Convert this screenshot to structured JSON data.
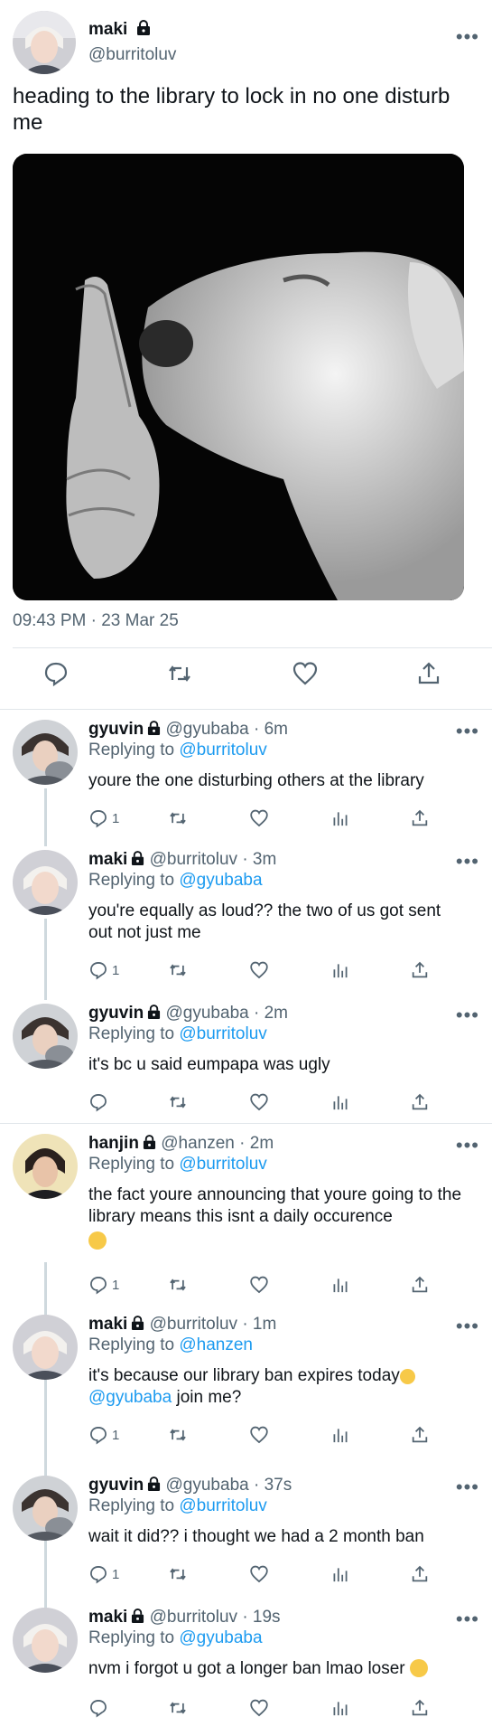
{
  "main": {
    "name": "maki",
    "handle": "@burritoluv",
    "text": "heading to the library to lock in no one disturb me",
    "time": "09:43 PM · 23 Mar 25"
  },
  "replies": [
    {
      "name": "gyuvin",
      "handle": "@gyubaba",
      "time": "· 6m",
      "reply_prefix": "Replying to",
      "reply_to": "@burritoluv",
      "text": "youre the one disturbing others at the library",
      "reply_count": "1",
      "avatar": "gyuvin"
    },
    {
      "name": "maki",
      "handle": "@burritoluv",
      "time": "· 3m",
      "reply_prefix": "Replying to",
      "reply_to": "@gyubaba",
      "text": "you're equally as loud?? the two of us got sent out not just me",
      "reply_count": "1",
      "avatar": "maki"
    },
    {
      "name": "gyuvin",
      "handle": "@gyubaba",
      "time": "· 2m",
      "reply_prefix": "Replying to",
      "reply_to": "@burritoluv",
      "text": "it's bc u said eumpapa was ugly",
      "reply_count": "",
      "avatar": "gyuvin"
    },
    {
      "name": "hanjin",
      "handle": "@hanzen",
      "time": "· 2m",
      "reply_prefix": "Replying to",
      "reply_to": "@burritoluv",
      "text": "the fact youre announcing that youre going to the library means this isnt a daily occurence",
      "reply_count": "1",
      "avatar": "hanjin"
    },
    {
      "name": "maki",
      "handle": "@burritoluv",
      "time": "· 1m",
      "reply_prefix": "Replying to",
      "reply_to": "@hanzen",
      "text": "it's because our library ban expires today",
      "text_mention": "@gyubaba",
      "text_after": " join me?",
      "reply_count": "1",
      "avatar": "maki"
    },
    {
      "name": "gyuvin",
      "handle": "@gyubaba",
      "time": "· 37s",
      "reply_prefix": "Replying to",
      "reply_to": "@burritoluv",
      "text": "wait it did?? i thought we had a 2 month ban",
      "reply_count": "1",
      "avatar": "gyuvin"
    },
    {
      "name": "maki",
      "handle": "@burritoluv",
      "time": "· 19s",
      "reply_prefix": "Replying to",
      "reply_to": "@gyubaba",
      "text": "nvm i forgot u got a longer ban lmao loser",
      "reply_count": "",
      "avatar": "maki"
    }
  ],
  "icons": {
    "reply": "reply-icon",
    "retweet": "retweet-icon",
    "like": "like-icon",
    "views": "views-icon",
    "share": "share-icon",
    "more": "more-icon",
    "lock": "lock-icon"
  },
  "colors": {
    "link": "#1d9bf0",
    "muted": "#536471",
    "divider": "#e1e6ea"
  }
}
